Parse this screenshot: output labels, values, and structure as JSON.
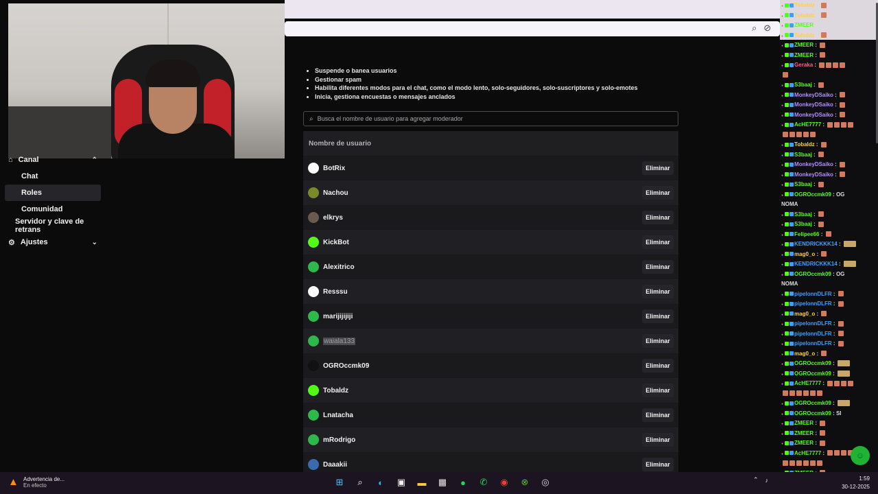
{
  "browser": {
    "icons": [
      "zoom-icon",
      "eye-off-icon",
      "star-icon",
      "extensions-icon",
      "menu-icon"
    ]
  },
  "sidebar": {
    "items": [
      {
        "label": "Canal",
        "type": "section",
        "expanded": true
      },
      {
        "label": "Chat",
        "type": "sub"
      },
      {
        "label": "Roles",
        "type": "sub",
        "active": true
      },
      {
        "label": "Comunidad",
        "type": "sub"
      },
      {
        "label": "Servidor y clave de retrans",
        "type": "sub"
      },
      {
        "label": "Ajustes",
        "type": "section",
        "expanded": false
      }
    ]
  },
  "main": {
    "bullets": [
      "Suspende o banea usuarios",
      "Gestionar spam",
      "Habilita diferentes modos para el chat, como el modo lento, solo-seguidores, solo-suscriptores y solo-emotes",
      "Inicia, gestiona encuestas o mensajes anclados"
    ],
    "search_placeholder": "Busca el nombre de usuario para agregar moderador",
    "column_header": "Nombre de usuario",
    "remove_label": "Eliminar",
    "moderators": [
      {
        "name": "BotRix",
        "avatar_color": "#ffffff"
      },
      {
        "name": "Nachou",
        "avatar_color": "#7a8a2a"
      },
      {
        "name": "elkrys",
        "avatar_color": "#6a5a50"
      },
      {
        "name": "KickBot",
        "avatar_color": "#53fc18"
      },
      {
        "name": "Alexitrico",
        "avatar_color": "#2fb84a"
      },
      {
        "name": "Resssu",
        "avatar_color": "#ffffff"
      },
      {
        "name": "marijijijiji",
        "avatar_color": "#2fb84a"
      },
      {
        "name": "waiala133",
        "avatar_color": "#2fb84a",
        "highlighted": true
      },
      {
        "name": "OGROccmk09",
        "avatar_color": "#111111"
      },
      {
        "name": "Tobaldz",
        "avatar_color": "#53fc18"
      },
      {
        "name": "Lnatacha",
        "avatar_color": "#2fb84a"
      },
      {
        "name": "mRodrigo",
        "avatar_color": "#2fb84a"
      },
      {
        "name": "Daaakii",
        "avatar_color": "#3a6ab0"
      }
    ]
  },
  "chat": {
    "messages": [
      {
        "user": "Tobaldz",
        "color": "#ffd23f",
        "text": "",
        "emotes": 1
      },
      {
        "user": "Tobaldz",
        "color": "#ffd23f",
        "text": "",
        "emotes": 1
      },
      {
        "user": "ZMEER",
        "color": "#53fc18",
        "text": "",
        "emotes": 0
      },
      {
        "user": "Tobaldz",
        "color": "#ffd23f",
        "text": "",
        "emotes": 1
      },
      {
        "user": "ZMEER",
        "color": "#53fc18",
        "text": "",
        "emotes": 1
      },
      {
        "user": "ZMEER",
        "color": "#53fc18",
        "text": "",
        "emotes": 1
      },
      {
        "user": "Geraka",
        "color": "#ff5f8a",
        "text": "",
        "emotes": 4
      },
      {
        "user": "",
        "color": "#ddd",
        "text": "",
        "emotes": 1
      },
      {
        "user": "S3baaj",
        "color": "#53fc18",
        "text": "",
        "emotes": 1
      },
      {
        "user": "MonkeyDSaiko",
        "color": "#b48cff",
        "text": "",
        "emotes": 1
      },
      {
        "user": "MonkeyDSaiko",
        "color": "#b48cff",
        "text": "",
        "emotes": 1
      },
      {
        "user": "MonkeyDSaiko",
        "color": "#b48cff",
        "text": "",
        "emotes": 1
      },
      {
        "user": "AcHE7777",
        "color": "#53fc18",
        "text": "",
        "emotes": 4
      },
      {
        "user": "",
        "color": "#ddd",
        "text": "",
        "emotes": 5
      },
      {
        "user": "Tobaldz",
        "color": "#ffd23f",
        "text": "",
        "emotes": 1
      },
      {
        "user": "S3baaj",
        "color": "#53fc18",
        "text": "",
        "emotes": 1
      },
      {
        "user": "MonkeyDSaiko",
        "color": "#b48cff",
        "text": "",
        "emotes": 1
      },
      {
        "user": "MonkeyDSaiko",
        "color": "#b48cff",
        "text": "",
        "emotes": 1
      },
      {
        "user": "S3baaj",
        "color": "#53fc18",
        "text": "",
        "emotes": 1
      },
      {
        "user": "OGROccmk09",
        "color": "#53fc18",
        "text": "OG",
        "emotes": 0
      },
      {
        "user": "",
        "color": "#ddd",
        "text": "NOMA",
        "emotes": 0
      },
      {
        "user": "S3baaj",
        "color": "#53fc18",
        "text": "",
        "emotes": 1
      },
      {
        "user": "S3baaj",
        "color": "#53fc18",
        "text": "",
        "emotes": 1
      },
      {
        "user": "Felipee66",
        "color": "#53fc18",
        "text": "",
        "emotes": 1
      },
      {
        "user": "KENDRICKKK14",
        "color": "#3aa0ff",
        "text": "",
        "emotes": 0,
        "big": true
      },
      {
        "user": "mag0_o",
        "color": "#ffd23f",
        "text": "",
        "emotes": 1
      },
      {
        "user": "KENDRICKKK14",
        "color": "#3aa0ff",
        "text": "",
        "emotes": 0,
        "big": true
      },
      {
        "user": "OGROccmk09",
        "color": "#53fc18",
        "text": "OG",
        "emotes": 0
      },
      {
        "user": "",
        "color": "#ddd",
        "text": "NOMA",
        "emotes": 0
      },
      {
        "user": "pipelonnDLFR",
        "color": "#3aa0ff",
        "text": "",
        "emotes": 1
      },
      {
        "user": "pipelonnDLFR",
        "color": "#3aa0ff",
        "text": "",
        "emotes": 1
      },
      {
        "user": "mag0_o",
        "color": "#ffd23f",
        "text": "",
        "emotes": 1
      },
      {
        "user": "pipelonnDLFR",
        "color": "#3aa0ff",
        "text": "",
        "emotes": 1
      },
      {
        "user": "pipelonnDLFR",
        "color": "#3aa0ff",
        "text": "",
        "emotes": 1
      },
      {
        "user": "pipelonnDLFR",
        "color": "#3aa0ff",
        "text": "",
        "emotes": 1
      },
      {
        "user": "mag0_o",
        "color": "#ffd23f",
        "text": "",
        "emotes": 1
      },
      {
        "user": "OGROccmk09",
        "color": "#53fc18",
        "text": "",
        "emotes": 0,
        "big": true
      },
      {
        "user": "OGROccmk09",
        "color": "#53fc18",
        "text": "",
        "emotes": 0,
        "big": true
      },
      {
        "user": "AcHE7777",
        "color": "#53fc18",
        "text": "",
        "emotes": 4
      },
      {
        "user": "",
        "color": "#ddd",
        "text": "",
        "emotes": 6
      },
      {
        "user": "OGROccmk09",
        "color": "#53fc18",
        "text": "",
        "emotes": 0,
        "big": true
      },
      {
        "user": "OGROccmk09",
        "color": "#53fc18",
        "text": "SI",
        "emotes": 0
      },
      {
        "user": "ZMEER",
        "color": "#53fc18",
        "text": "",
        "emotes": 1
      },
      {
        "user": "ZMEER",
        "color": "#53fc18",
        "text": "",
        "emotes": 1
      },
      {
        "user": "ZMEER",
        "color": "#53fc18",
        "text": "",
        "emotes": 1
      },
      {
        "user": "AcHE7777",
        "color": "#53fc18",
        "text": "",
        "emotes": 4
      },
      {
        "user": "",
        "color": "#ddd",
        "text": "",
        "emotes": 6
      },
      {
        "user": "ZMEER",
        "color": "#53fc18",
        "text": "",
        "emotes": 1
      },
      {
        "user": "ZMEER",
        "color": "#53fc18",
        "text": "",
        "emotes": 1
      }
    ]
  },
  "taskbar": {
    "alert_title": "Advertencia de...",
    "alert_sub": "En efecto",
    "apps": [
      {
        "name": "start-icon",
        "glyph": "⊞",
        "color": "#4cc2ff"
      },
      {
        "name": "search-icon",
        "glyph": "⌕",
        "color": "#ffffff"
      },
      {
        "name": "edge-icon",
        "glyph": "◐",
        "color": "#2fb3e8"
      },
      {
        "name": "store-icon",
        "glyph": "▣",
        "color": "#f2f2f2"
      },
      {
        "name": "explorer-icon",
        "glyph": "▬",
        "color": "#ffc83d"
      },
      {
        "name": "app-icon",
        "glyph": "▦",
        "color": "#e8e8e8"
      },
      {
        "name": "spotify-icon",
        "glyph": "●",
        "color": "#1ed760"
      },
      {
        "name": "whatsapp-icon",
        "glyph": "✆",
        "color": "#25d366"
      },
      {
        "name": "chrome-icon",
        "glyph": "◉",
        "color": "#e94235"
      },
      {
        "name": "xbox-icon",
        "glyph": "⊗",
        "color": "#5dc21e"
      },
      {
        "name": "obs-icon",
        "glyph": "◎",
        "color": "#dddddd"
      }
    ],
    "time": "1:59",
    "date": "30-12-2025"
  }
}
